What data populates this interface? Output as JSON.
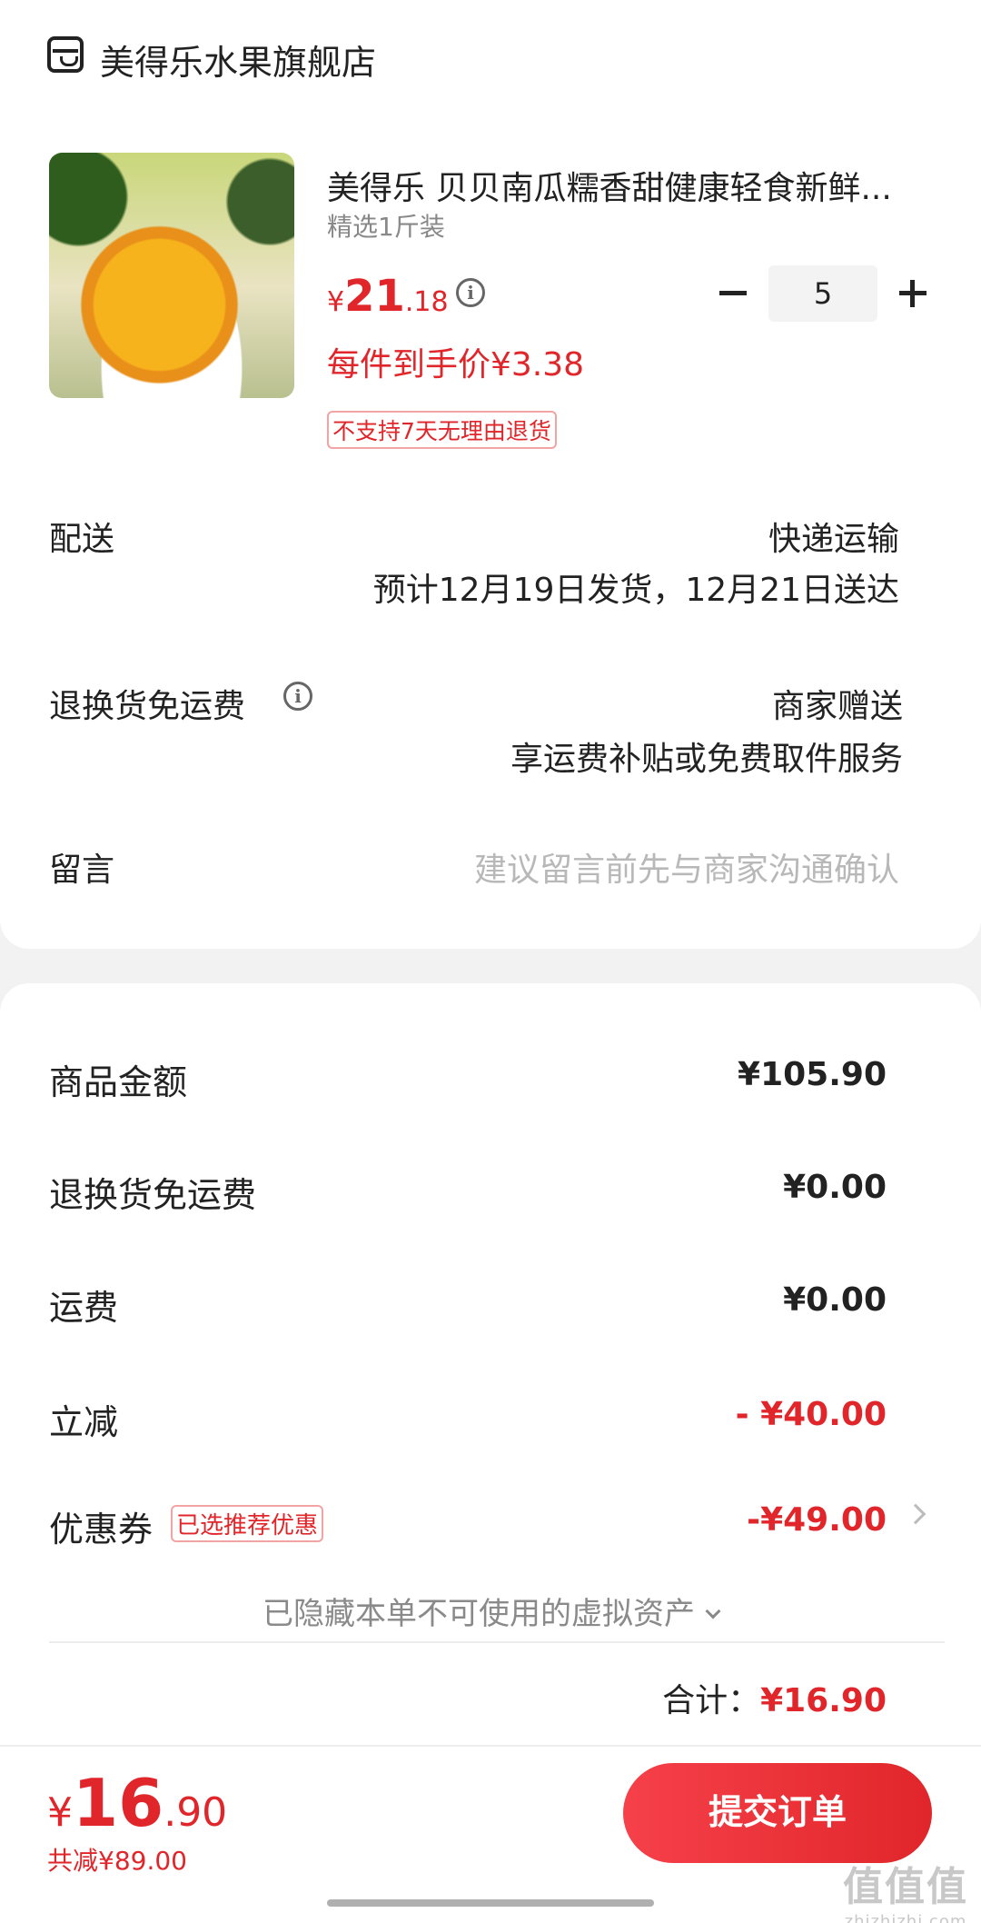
{
  "store": {
    "name": "美得乐水果旗舰店",
    "icon": "store-icon"
  },
  "product": {
    "title": "美得乐 贝贝南瓜糯香甜健康轻食新鲜...",
    "spec": "精选1斤装",
    "price_currency": "¥",
    "price_int": "21",
    "price_dec": ".18",
    "per_price": "每件到手价¥3.38",
    "tag": "不支持7天无理由退货",
    "quantity": "5"
  },
  "delivery": {
    "label": "配送",
    "method": "快递运输",
    "eta": "预计12月19日发货，12月21日送达"
  },
  "return_shipping": {
    "label": "退换货免运费",
    "value": "商家赠送",
    "desc": "享运费补贴或免费取件服务"
  },
  "message": {
    "label": "留言",
    "placeholder": "建议留言前先与商家沟通确认"
  },
  "summary": {
    "goods_label": "商品金额",
    "goods_value": "¥105.90",
    "return_label": "退换货免运费",
    "return_value": "¥0.00",
    "shipping_label": "运费",
    "shipping_value": "¥0.00",
    "discount_label": "立减",
    "discount_value": "- ¥40.00",
    "coupon_label": "优惠券",
    "coupon_tag": "已选推荐优惠",
    "coupon_value": "-¥49.00",
    "hidden_assets": "已隐藏本单不可使用的虚拟资产",
    "total_label": "合计：",
    "total_value": "¥16.90"
  },
  "footer": {
    "pay_currency": "¥",
    "pay_int": "16",
    "pay_dec": ".90",
    "saved": "共减¥89.00",
    "submit_label": "提交订单"
  },
  "watermark": {
    "main": "值值值",
    "sub": "zhizhizhi.com"
  },
  "colors": {
    "accent": "#e0262a",
    "placeholder": "#b8b8b8"
  }
}
